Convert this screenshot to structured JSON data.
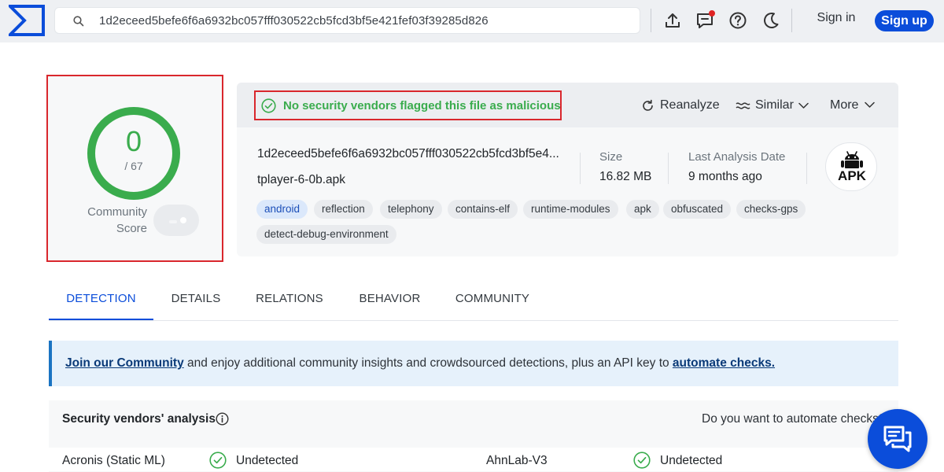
{
  "header": {
    "logo": "virustotal-logo",
    "search_value": "1d2eceed5befe6f6a6932bc057fff030522cb5fcd3bf5e421fef03f39285d826",
    "icons": [
      "upload-icon",
      "chat-notification-icon",
      "help-icon",
      "dark-mode-icon"
    ],
    "signin_label": "Sign in",
    "signup_label": "Sign up",
    "accent_color": "#0b4dda"
  },
  "score": {
    "detections": "0",
    "total": "/ 67",
    "community_label_1": "Community",
    "community_label_2": "Score",
    "status_color": "#3aac4d"
  },
  "file": {
    "verdict": "No security vendors flagged this file as malicious",
    "actions": {
      "reanalyze": "Reanalyze",
      "similar": "Similar",
      "more": "More"
    },
    "hash": "1d2eceed5befe6f6a6932bc057fff030522cb5fcd3bf5e4...",
    "name": "tplayer-6-0b.apk",
    "size_label": "Size",
    "size_value": "16.82 MB",
    "date_label": "Last Analysis Date",
    "date_value": "9 months ago",
    "type_badge": "APK",
    "tags": [
      "android",
      "reflection",
      "telephony",
      "contains-elf",
      "runtime-modules",
      "apk",
      "obfuscated",
      "checks-gps",
      "detect-debug-environment"
    ]
  },
  "tabs": [
    "DETECTION",
    "DETAILS",
    "RELATIONS",
    "BEHAVIOR",
    "COMMUNITY"
  ],
  "banner": {
    "link1": "Join our Community",
    "middle": " and enjoy additional community insights and crowdsourced detections, plus an API key to ",
    "link2": "automate checks."
  },
  "vendors": {
    "heading": "Security vendors' analysis",
    "automate": "Do you want to automate checks?",
    "rows": [
      {
        "name": "Acronis (Static ML)",
        "result": "Undetected"
      },
      {
        "name": "AhnLab-V3",
        "result": "Undetected"
      }
    ]
  }
}
